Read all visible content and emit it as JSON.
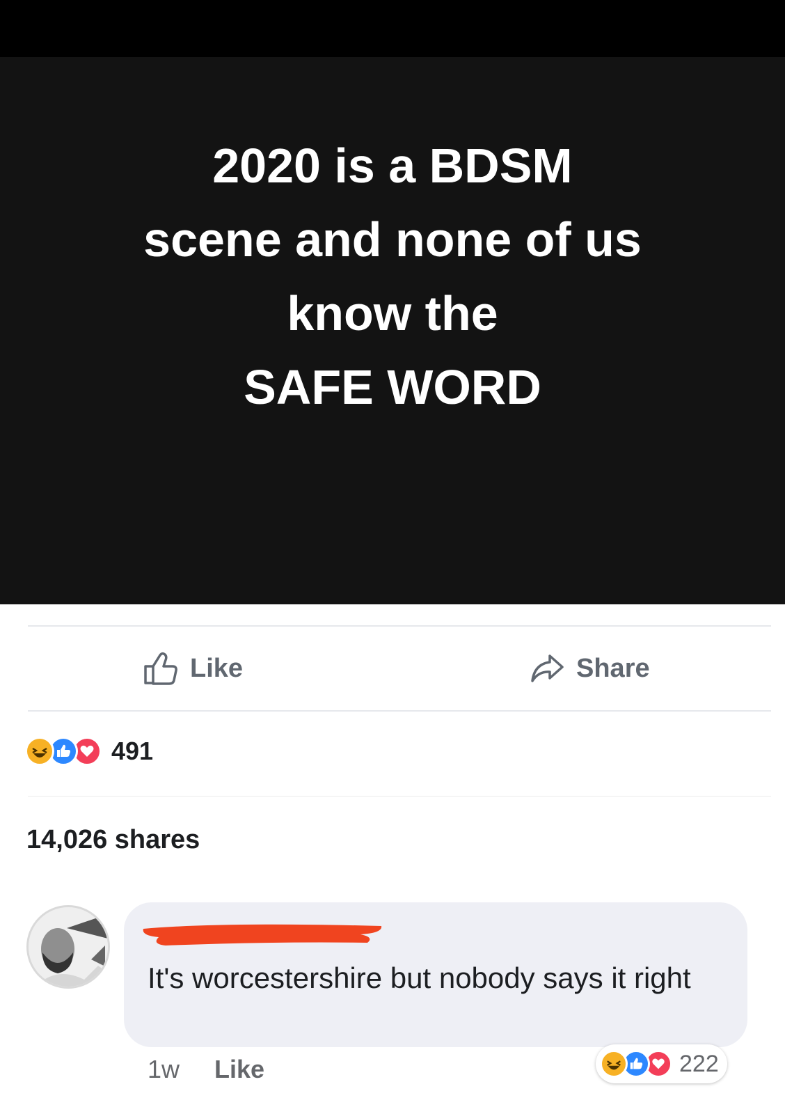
{
  "post": {
    "meme_lines": [
      "2020 is a BDSM",
      "scene and none of us",
      "know the",
      "SAFE WORD"
    ]
  },
  "actions": {
    "like_label": "Like",
    "share_label": "Share",
    "like_icon": "thumbs-up-icon",
    "share_icon": "share-arrow-icon"
  },
  "reactions": {
    "types": [
      "haha",
      "like",
      "love"
    ],
    "count": "491"
  },
  "shares": {
    "text": "14,026 shares"
  },
  "comment": {
    "text": "It's worcestershire but nobody says it right",
    "time": "1w",
    "like_label": "Like",
    "reaction_types": [
      "haha",
      "like",
      "love"
    ],
    "reaction_count": "222"
  },
  "colors": {
    "meme_bg": "#131313",
    "redaction": "#f0441f",
    "like_blue": "#2d88ff",
    "love_red": "#f33e58",
    "haha_yellow": "#f7b125"
  }
}
